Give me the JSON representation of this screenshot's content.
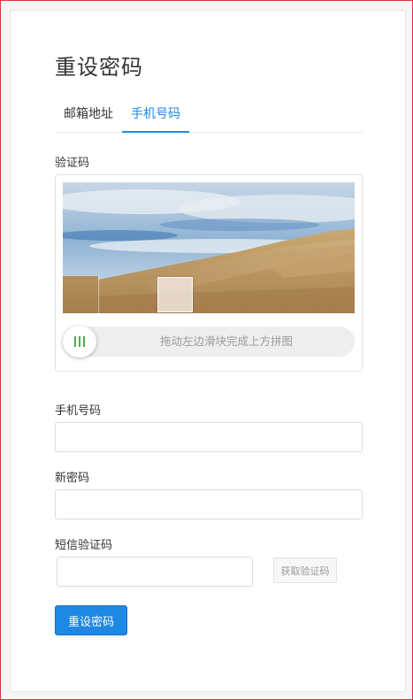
{
  "page": {
    "title": "重设密码"
  },
  "tabs": [
    {
      "label": "邮箱地址",
      "active": false
    },
    {
      "label": "手机号码",
      "active": true
    }
  ],
  "captcha": {
    "label": "验证码",
    "slider_hint": "拖动左边滑块完成上方拼图",
    "handle_color": "#4caf50"
  },
  "form": {
    "phone_label": "手机号码",
    "phone_value": "",
    "new_password_label": "新密码",
    "new_password_value": "",
    "sms_code_label": "短信验证码",
    "sms_code_value": "",
    "get_code_button": "获取验证码",
    "submit_button": "重设密码"
  },
  "colors": {
    "accent": "#1e88e5",
    "frame_border": "#d9363e"
  }
}
